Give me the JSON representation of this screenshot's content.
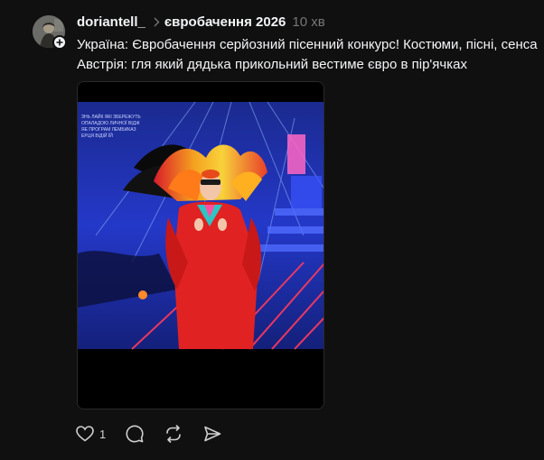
{
  "post": {
    "username": "doriantell_",
    "topic": "євробачення 2026",
    "time_ago": "10 хв",
    "lines": [
      "Україна: Євробачення серйозний пісенний конкурс! Костюми, пісні, сенса",
      "Австрія: гля який дядька прикольний вестиме євро в пір'ячках"
    ],
    "media_overlay_text": [
      "ЗНЬ ЛАЙК ЯКІ ЗБЕРЕЖУТЬ",
      "ОПАЛАДОЮ ЛИЧНОЇ ВІДЖ",
      "ЯЕ ПРОГРАМ ЛЕМБИКАЗ",
      "ЕРЦЯ ВІДІЙ ЇЙ"
    ]
  },
  "actions": {
    "like_count": "1",
    "icons": [
      "heart-icon",
      "comment-icon",
      "repost-icon",
      "share-icon"
    ]
  },
  "colors": {
    "background": "#101010",
    "text": "#f3f5f7",
    "muted": "#777777"
  }
}
